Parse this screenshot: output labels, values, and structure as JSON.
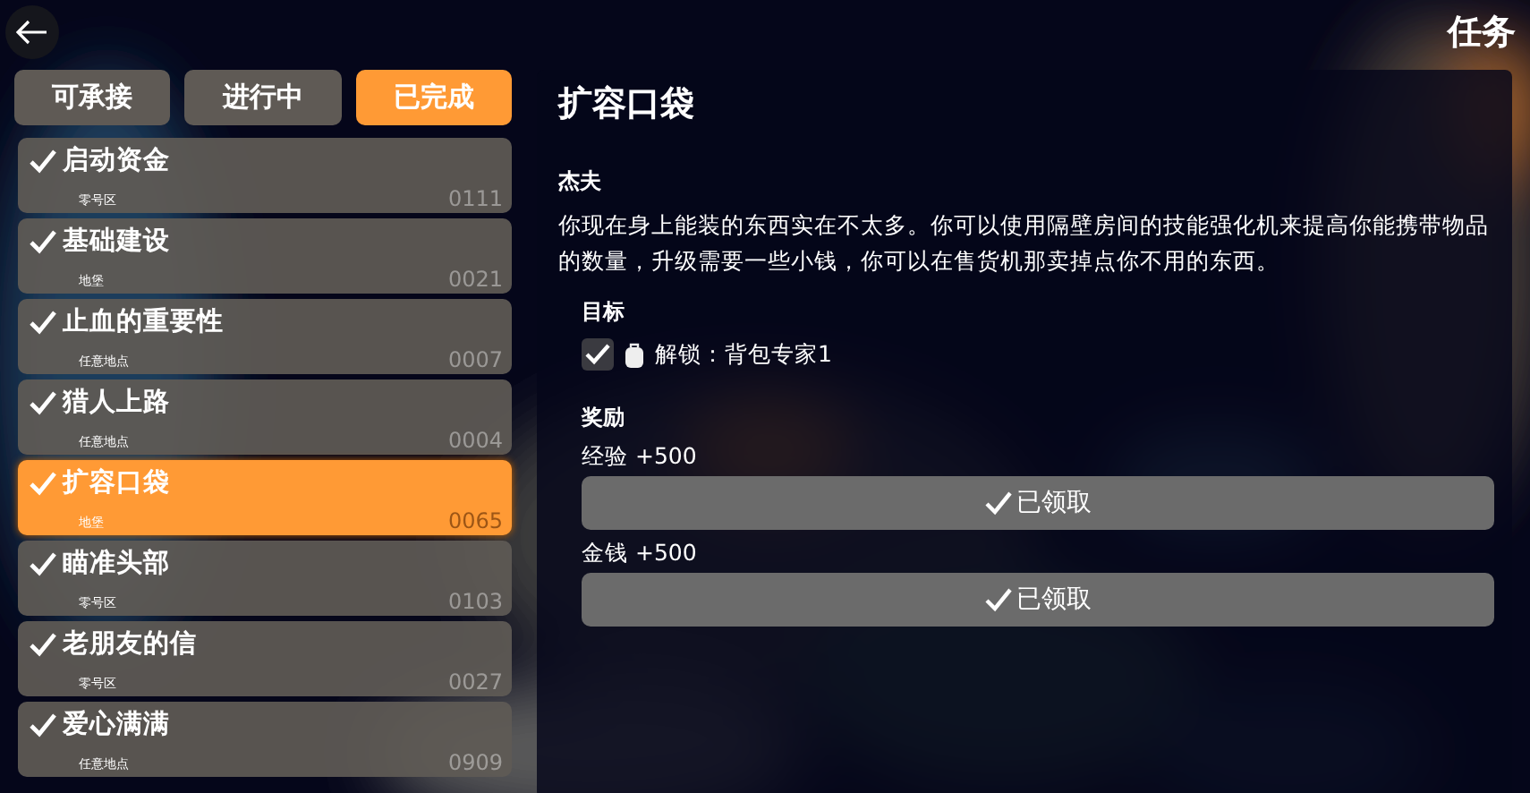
{
  "header": {
    "title": "任务"
  },
  "tabs": [
    {
      "label": "可承接",
      "selected": false
    },
    {
      "label": "进行中",
      "selected": false
    },
    {
      "label": "已完成",
      "selected": true
    }
  ],
  "quests": [
    {
      "title": "启动资金",
      "area": "零号区",
      "code": "0111",
      "completed": true,
      "selected": false
    },
    {
      "title": "基础建设",
      "area": "地堡",
      "code": "0021",
      "completed": true,
      "selected": false
    },
    {
      "title": "止血的重要性",
      "area": "任意地点",
      "code": "0007",
      "completed": true,
      "selected": false
    },
    {
      "title": "猎人上路",
      "area": "任意地点",
      "code": "0004",
      "completed": true,
      "selected": false
    },
    {
      "title": "扩容口袋",
      "area": "地堡",
      "code": "0065",
      "completed": true,
      "selected": true
    },
    {
      "title": "瞄准头部",
      "area": "零号区",
      "code": "0103",
      "completed": true,
      "selected": false
    },
    {
      "title": "老朋友的信",
      "area": "零号区",
      "code": "0027",
      "completed": true,
      "selected": false
    },
    {
      "title": "爱心满满",
      "area": "任意地点",
      "code": "0909",
      "completed": true,
      "selected": false
    }
  ],
  "detail": {
    "title": "扩容口袋",
    "giver": "杰夫",
    "description": "你现在身上能装的东西实在不太多。你可以使用隔壁房间的技能强化机来提高你能携带物品的数量，升级需要一些小钱，你可以在售货机那卖掉点你不用的东西。",
    "objectives_heading": "目标",
    "objectives": [
      {
        "text": "解锁：背包专家1",
        "checked": true
      }
    ],
    "rewards_heading": "奖励",
    "rewards": [
      {
        "label": "经验 +500",
        "button": "已领取",
        "claimed": true
      },
      {
        "label": "金钱 +500",
        "button": "已领取",
        "claimed": true
      }
    ]
  }
}
